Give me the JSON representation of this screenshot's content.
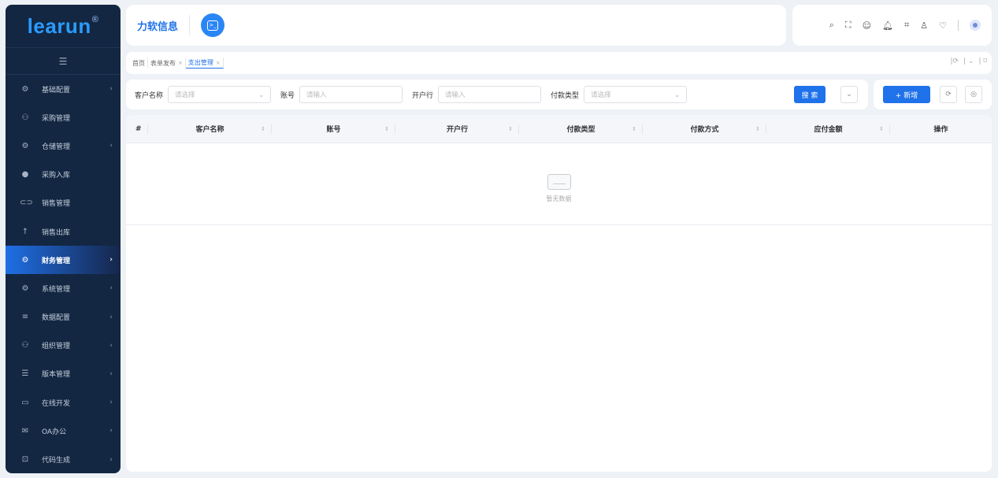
{
  "logo": {
    "text": "learun",
    "mark": "®"
  },
  "sidebar": {
    "collapse_icon": "menu-fold-icon",
    "items": [
      {
        "label": "基础配置",
        "icon": "gear-icon",
        "arrow": true
      },
      {
        "label": "采购管理",
        "icon": "org-icon",
        "arrow": false
      },
      {
        "label": "仓储管理",
        "icon": "gear-icon",
        "arrow": true
      },
      {
        "label": "采购入库",
        "icon": "circle-icon",
        "arrow": false
      },
      {
        "label": "销售管理",
        "icon": "link-icon",
        "arrow": false
      },
      {
        "label": "销售出库",
        "icon": "arrow-up-icon",
        "arrow": false
      },
      {
        "label": "财务管理",
        "icon": "gear-icon",
        "arrow": true,
        "active": true
      },
      {
        "label": "系统管理",
        "icon": "gear-icon",
        "arrow": true
      },
      {
        "label": "数据配置",
        "icon": "list-icon",
        "arrow": true
      },
      {
        "label": "组织管理",
        "icon": "org-icon",
        "arrow": true
      },
      {
        "label": "版本管理",
        "icon": "menu-icon",
        "arrow": true
      },
      {
        "label": "在线开发",
        "icon": "monitor-icon",
        "arrow": true
      },
      {
        "label": "OA办公",
        "icon": "mail-icon",
        "arrow": true
      },
      {
        "label": "代码生成",
        "icon": "code-icon",
        "arrow": true
      }
    ]
  },
  "header": {
    "brand": "力软信息",
    "terminal_icon": "terminal-icon"
  },
  "toolbar_icons": [
    "search-icon",
    "fullscreen-icon",
    "chat-icon",
    "bell-icon",
    "translate-icon",
    "user-icon",
    "shirt-icon"
  ],
  "tabs": [
    {
      "label": "首页",
      "closable": false
    },
    {
      "label": "表单发布",
      "closable": true
    },
    {
      "label": "支出管理",
      "closable": true,
      "active": true
    }
  ],
  "filters": {
    "customer_label": "客户名称",
    "customer_placeholder": "请选择",
    "account_label": "账号",
    "account_placeholder": "请输入",
    "bank_label": "开户行",
    "bank_placeholder": "请输入",
    "paytype_label": "付款类型",
    "paytype_placeholder": "请选择",
    "search_button": "搜 索"
  },
  "actions": {
    "add_button": "+ 新增"
  },
  "table": {
    "columns": [
      "#",
      "客户名称",
      "账号",
      "开户行",
      "付款类型",
      "付款方式",
      "应付金额",
      "操作"
    ],
    "rows": [],
    "empty_text": "暂无数据"
  },
  "colors": {
    "primary": "#1f72ea",
    "sidebar_bg": "#132742"
  }
}
